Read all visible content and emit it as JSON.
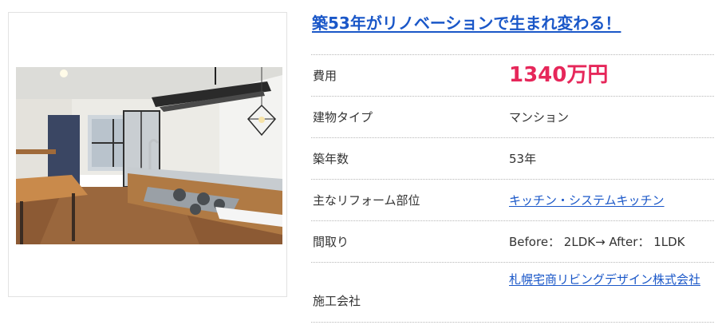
{
  "article": {
    "title": "築53年がリノベーションで生まれ変わる！"
  },
  "photo": {
    "alt": "キッチン・システムキッチン"
  },
  "specs": {
    "cost": {
      "label": "費用",
      "value": "1340万円"
    },
    "building_type": {
      "label": "建物タイプ",
      "value": "マンション"
    },
    "age": {
      "label": "築年数",
      "value": "53年"
    },
    "reform_area": {
      "label": "主なリフォーム部位",
      "value": "キッチン・システムキッチン"
    },
    "layout": {
      "label": "間取り",
      "value": "Before： 2LDK→ After： 1LDK"
    },
    "company": {
      "label": "施工会社",
      "value": "札幌宅商リビングデザイン株式会社"
    }
  },
  "colors": {
    "link": "#1a57c8",
    "price": "#e6275a"
  }
}
